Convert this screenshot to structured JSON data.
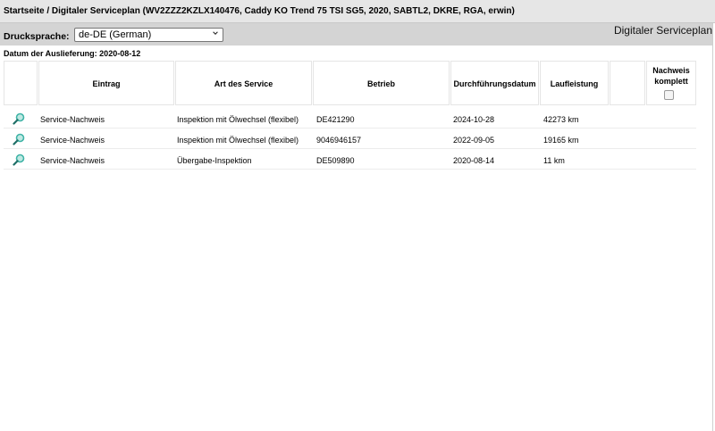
{
  "header": {
    "title": "Startseite / Digitaler Serviceplan (WV2ZZZ2KZLX140476, Caddy KO Trend 75 TSI SG5, 2020, SABTL2, DKRE, RGA, erwin)"
  },
  "toolbar": {
    "print_language_label": "Drucksprache:",
    "print_language_value": "de-DE (German)",
    "page_name": "Digitaler Serviceplan"
  },
  "delivery_date_text": "Datum der Auslieferung: 2020-08-12",
  "table": {
    "columns": {
      "entry": "Eintrag",
      "service_type": "Art des Service",
      "workshop": "Betrieb",
      "date": "Durchführungsdatum",
      "mileage": "Laufleistung",
      "proof_complete_line1": "Nachweis",
      "proof_complete_line2": "komplett"
    },
    "rows": [
      {
        "entry": "Service-Nachweis",
        "service_type": "Inspektion mit Ölwechsel (flexibel)",
        "workshop": "DE421290",
        "date": "2024-10-28",
        "mileage": "42273 km",
        "icon": "magnifier-icon"
      },
      {
        "entry": "Service-Nachweis",
        "service_type": "Inspektion mit Ölwechsel (flexibel)",
        "workshop": "9046946157",
        "date": "2022-09-05",
        "mileage": "19165 km",
        "icon": "magnifier-icon"
      },
      {
        "entry": "Service-Nachweis",
        "service_type": "Übergabe-Inspektion",
        "workshop": "DE509890",
        "date": "2020-08-14",
        "mileage": "11 km",
        "icon": "magnifier-icon"
      }
    ]
  },
  "colors": {
    "titlebar_bg": "#e6e6e6",
    "toolbar_bg": "#d4d4d4",
    "magnifier_lens": "#3fb3a6"
  }
}
